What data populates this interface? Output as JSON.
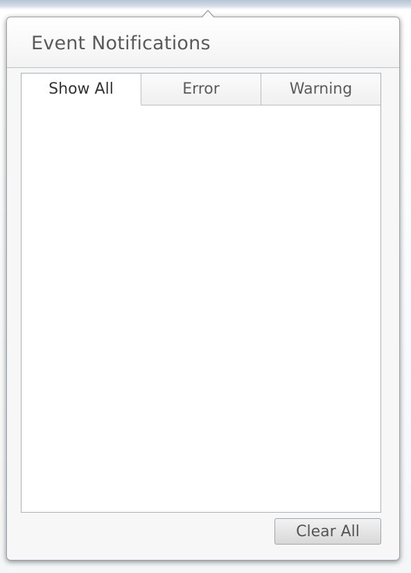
{
  "popup": {
    "title": "Event Notifications"
  },
  "tabs": [
    {
      "label": "Show All",
      "active": true
    },
    {
      "label": "Error",
      "active": false
    },
    {
      "label": "Warning",
      "active": false
    }
  ],
  "notifications": [],
  "footer": {
    "clear_all_label": "Clear All"
  },
  "colors": {
    "title_text": "#5a5a5a",
    "border": "#9aa1a8",
    "button_bg": "#d8d8d8"
  }
}
